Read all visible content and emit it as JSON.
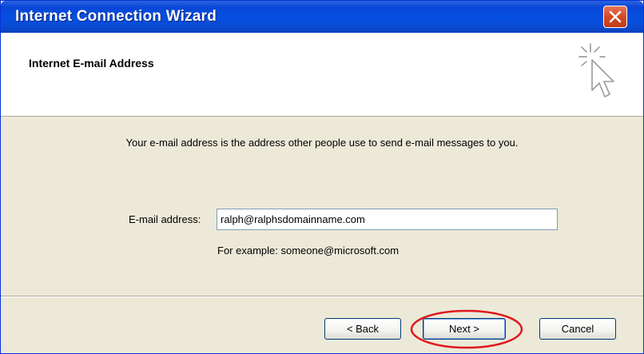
{
  "window": {
    "title": "Internet Connection Wizard",
    "titlebar_color": "#0a46d6",
    "close_button_color": "#d24a25"
  },
  "header": {
    "title": "Internet E-mail Address",
    "icon": "wizard-sparkle-cursor-icon"
  },
  "body": {
    "description": "Your e-mail address is the address other people use to send e-mail messages to you.",
    "email_label": "E-mail address:",
    "email_value": "ralph@ralphsdomainname.com",
    "example_text": "For example: someone@microsoft.com"
  },
  "buttons": {
    "back": "< Back",
    "next": "Next >",
    "cancel": "Cancel"
  },
  "annotation": {
    "highlight": "red-oval-around-next-button",
    "color": "#e0181e"
  }
}
